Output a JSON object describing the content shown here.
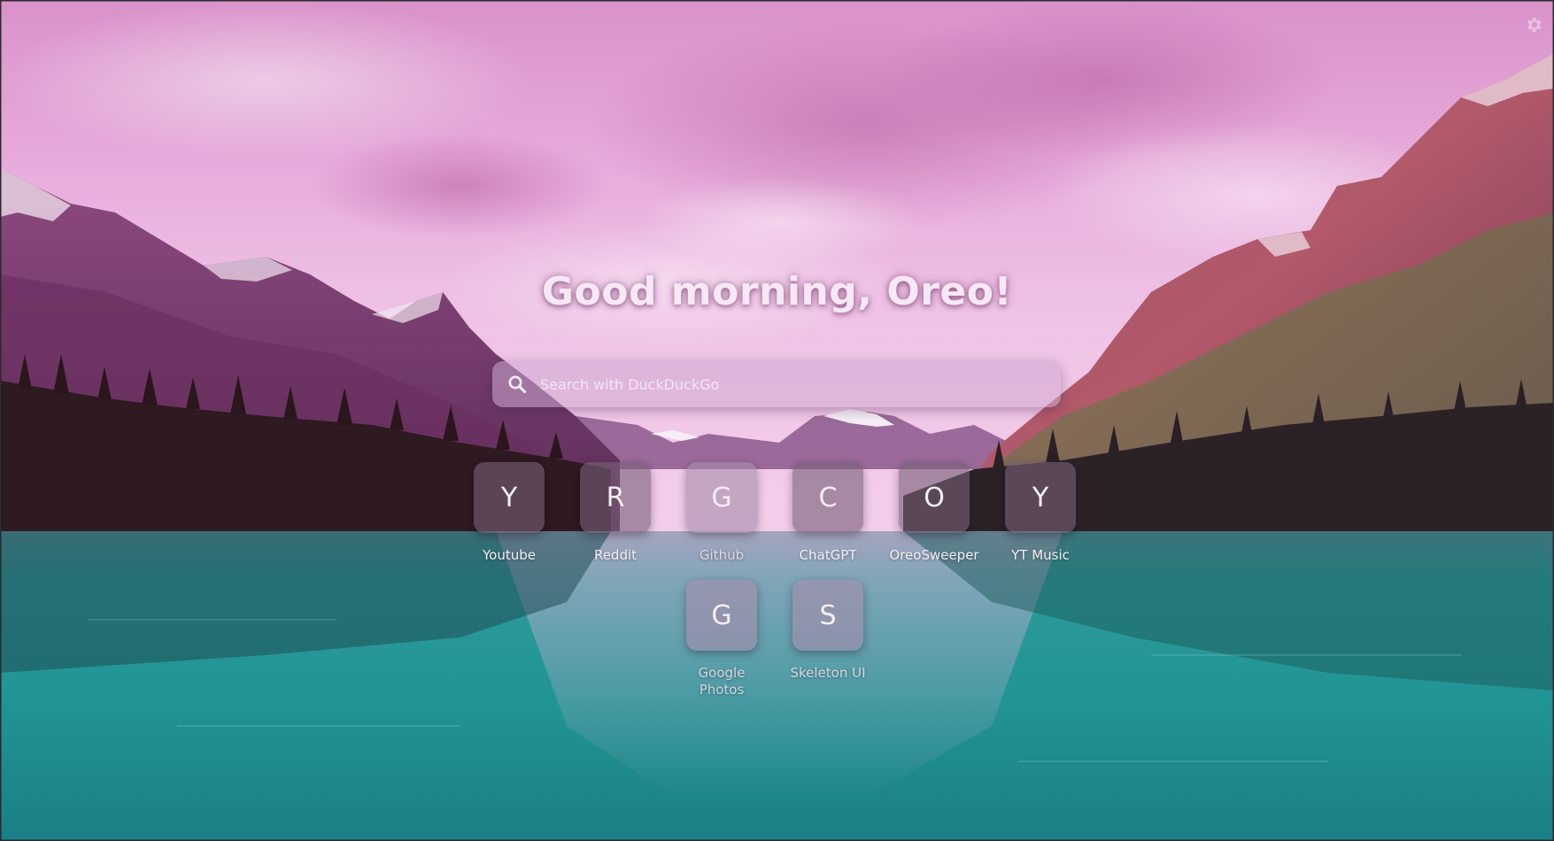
{
  "greeting": "Good morning, Oreo!",
  "search": {
    "placeholder": "Search with DuckDuckGo",
    "icon": "search-icon"
  },
  "settings": {
    "icon": "gear-icon"
  },
  "shortcuts": [
    {
      "letter": "Y",
      "label": "Youtube"
    },
    {
      "letter": "R",
      "label": "Reddit"
    },
    {
      "letter": "G",
      "label": "Github"
    },
    {
      "letter": "C",
      "label": "ChatGPT"
    },
    {
      "letter": "O",
      "label": "OreoSweeper"
    },
    {
      "letter": "Y",
      "label": "YT Music"
    },
    {
      "letter": "G",
      "label": "Google Photos"
    },
    {
      "letter": "S",
      "label": "Skeleton UI"
    }
  ],
  "colors": {
    "sky": "#e7a9dc",
    "mountains": "#7a3e74",
    "forest": "#2c1a22",
    "lake": "#2a9a9a",
    "tile": "#786078",
    "text": "#f6e8f4"
  }
}
